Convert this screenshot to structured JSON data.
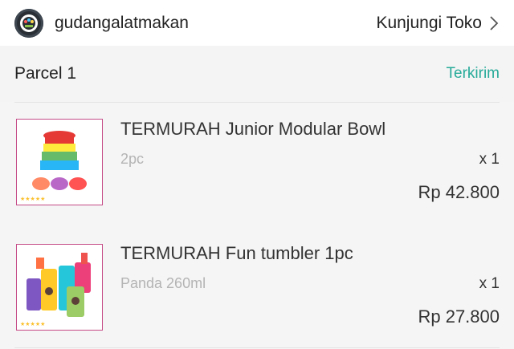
{
  "shop": {
    "name": "gudangalatmakan",
    "visit_label": "Kunjungi Toko",
    "avatar_icon": "shop-logo"
  },
  "parcel": {
    "title": "Parcel 1",
    "status": "Terkirim",
    "status_color": "#26aa99"
  },
  "items": [
    {
      "name": "TERMURAH Junior Modular Bowl",
      "variant": "2pc",
      "quantity": "x 1",
      "price": "Rp 42.800",
      "image_icon": "stacked-bowls-image"
    },
    {
      "name": "TERMURAH Fun tumbler 1pc",
      "variant": "Panda 260ml",
      "quantity": "x 1",
      "price": "Rp 27.800",
      "image_icon": "tumbler-cups-image"
    }
  ]
}
